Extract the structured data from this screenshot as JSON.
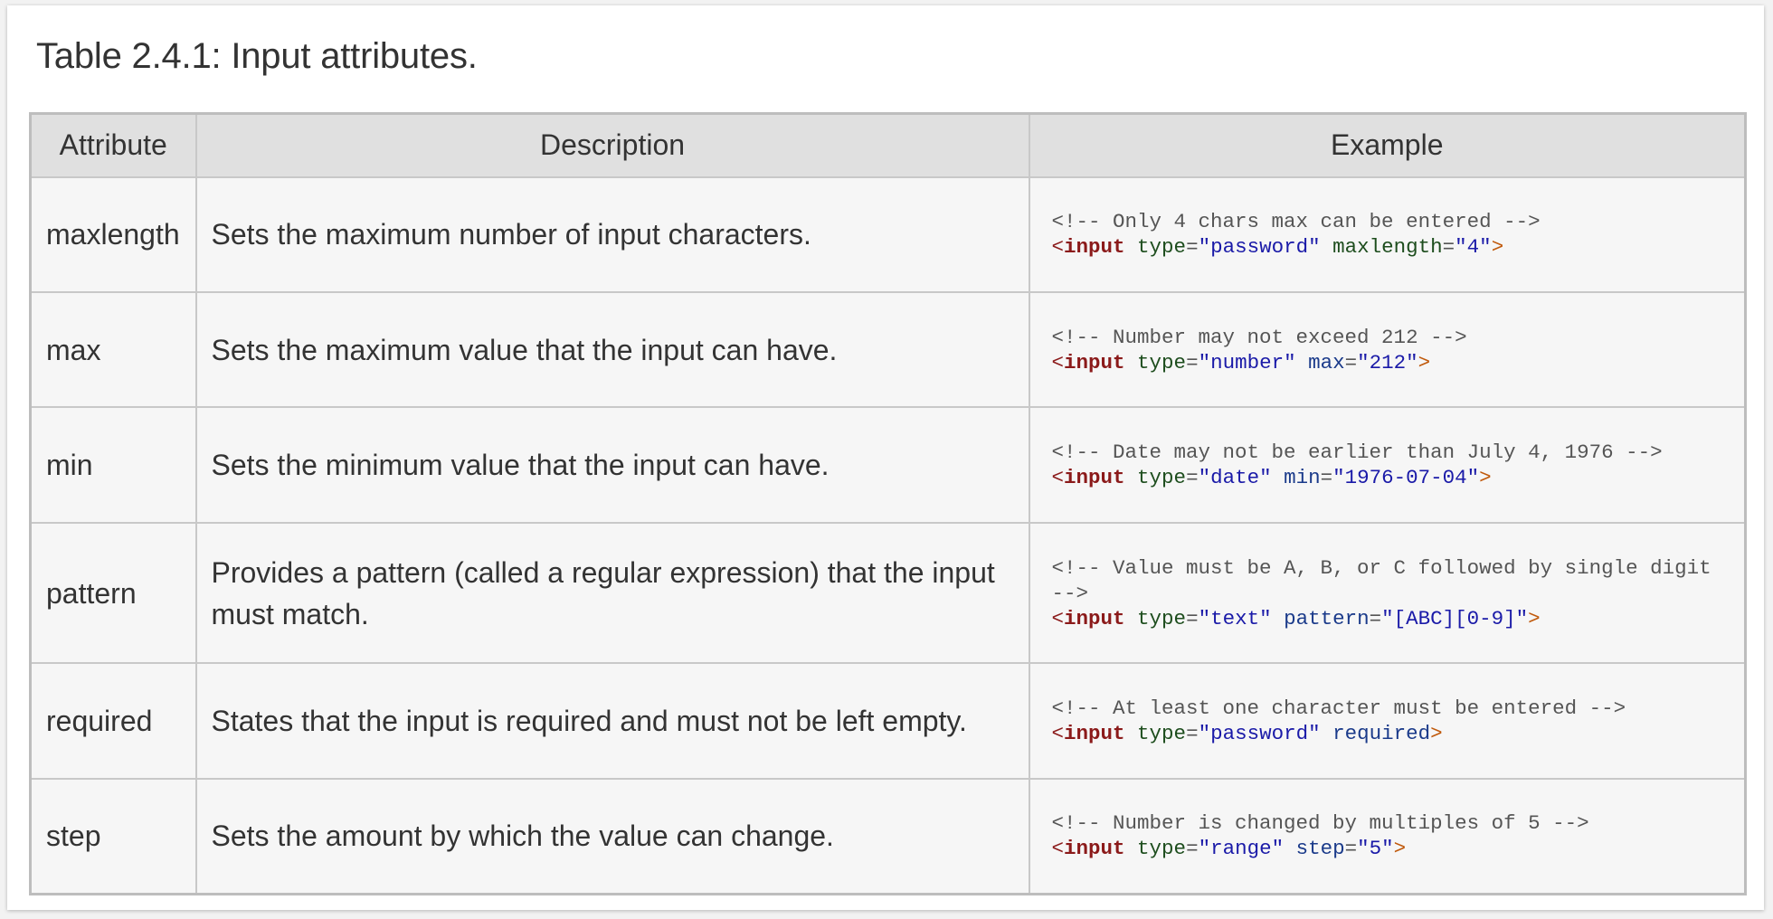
{
  "caption": "Table 2.4.1: Input attributes.",
  "table": {
    "headers": [
      "Attribute",
      "Description",
      "Example"
    ],
    "rows": [
      {
        "attribute": "maxlength",
        "description": "Sets the maximum number of input characters.",
        "comment": "<!-- Only 4 chars max can be entered -->",
        "tag_open": "<",
        "tag_name": "input",
        "attr1_name": "type",
        "attr1_value": "\"password\"",
        "attr2_name": "maxlength",
        "attr2_value": "\"4\"",
        "tag_close": ">"
      },
      {
        "attribute": "max",
        "description": "Sets the maximum value that the input can have.",
        "comment": "<!-- Number may not exceed 212 -->",
        "tag_open": "<",
        "tag_name": "input",
        "attr1_name": "type",
        "attr1_value": "\"number\"",
        "attr2_name": "max",
        "attr2_value": "\"212\"",
        "tag_close": ">"
      },
      {
        "attribute": "min",
        "description": "Sets the minimum value that the input can have.",
        "comment": "<!-- Date may not be earlier than July 4, 1976 -->",
        "tag_open": "<",
        "tag_name": "input",
        "attr1_name": "type",
        "attr1_value": "\"date\"",
        "attr2_name": "min",
        "attr2_value": "\"1976-07-04\"",
        "tag_close": ">"
      },
      {
        "attribute": "pattern",
        "description": "Provides a pattern (called a regular expression) that the input must match.",
        "comment": "<!-- Value must be A, B, or C followed by single digit -->",
        "tag_open": "<",
        "tag_name": "input",
        "attr1_name": "type",
        "attr1_value": "\"text\"",
        "attr2_name": "pattern",
        "attr2_value": "\"[ABC][0-9]\"",
        "tag_close": ">"
      },
      {
        "attribute": "required",
        "description": "States that the input is required and must not be left empty.",
        "comment": "<!-- At least one character must be entered -->",
        "tag_open": "<",
        "tag_name": "input",
        "attr1_name": "type",
        "attr1_value": "\"password\"",
        "attr2_name": "required",
        "attr2_value": "",
        "tag_close": ">"
      },
      {
        "attribute": "step",
        "description": "Sets the amount by which the value can change.",
        "comment": "<!-- Number is changed by multiples of 5 -->",
        "tag_open": "<",
        "tag_name": "input",
        "attr1_name": "type",
        "attr1_value": "\"range\"",
        "attr2_name": "step",
        "attr2_value": "\"5\"",
        "tag_close": ">"
      }
    ]
  }
}
